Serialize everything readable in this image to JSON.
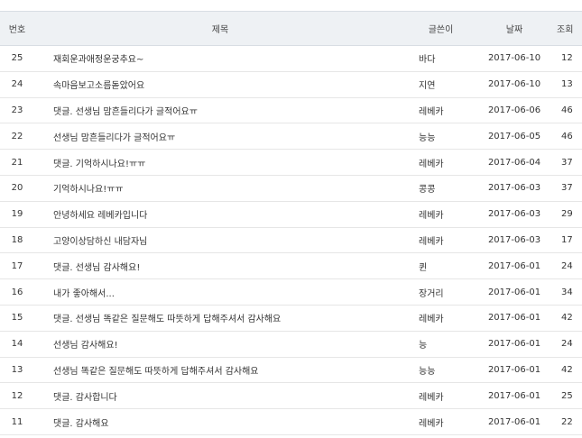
{
  "table": {
    "headers": {
      "no": "번호",
      "title": "제목",
      "author": "글쓴이",
      "date": "날짜",
      "views": "조회"
    },
    "rows": [
      {
        "no": "25",
        "title": "재회운과애정운궁추요~",
        "author": "바다",
        "date": "2017-06-10",
        "views": "12"
      },
      {
        "no": "24",
        "title": "속마음보고소름돋았어요",
        "author": "지연",
        "date": "2017-06-10",
        "views": "13"
      },
      {
        "no": "23",
        "title": "댓글. 선생님 맘흔들리다가 글적어요ㅠ",
        "author": "레베카",
        "date": "2017-06-06",
        "views": "46"
      },
      {
        "no": "22",
        "title": "선생님 맘흔들리다가 글적어요ㅠ",
        "author": "능능",
        "date": "2017-06-05",
        "views": "46"
      },
      {
        "no": "21",
        "title": "댓글. 기억하시나요!ㅠㅠ",
        "author": "레베카",
        "date": "2017-06-04",
        "views": "37"
      },
      {
        "no": "20",
        "title": "기억하시나요!ㅠㅠ",
        "author": "콩콩",
        "date": "2017-06-03",
        "views": "37"
      },
      {
        "no": "19",
        "title": "안녕하세요 레베카입니다",
        "author": "레베카",
        "date": "2017-06-03",
        "views": "29"
      },
      {
        "no": "18",
        "title": "고양이상담하신 내담자님",
        "author": "레베카",
        "date": "2017-06-03",
        "views": "17"
      },
      {
        "no": "17",
        "title": "댓글. 선생님 감사해요!",
        "author": "퀸",
        "date": "2017-06-01",
        "views": "24"
      },
      {
        "no": "16",
        "title": "내가 좋아해서...",
        "author": "장거리",
        "date": "2017-06-01",
        "views": "34"
      },
      {
        "no": "15",
        "title": "댓글. 선생님 똑같은 질문해도 따뜻하게 답해주셔서 감사해요",
        "author": "레베카",
        "date": "2017-06-01",
        "views": "42"
      },
      {
        "no": "14",
        "title": "선생님 감사해요!",
        "author": "능",
        "date": "2017-06-01",
        "views": "24"
      },
      {
        "no": "13",
        "title": "선생님 똑같은 질문해도 따뜻하게 답해주셔서 감사해요",
        "author": "능능",
        "date": "2017-06-01",
        "views": "42"
      },
      {
        "no": "12",
        "title": "댓글. 감사합니다",
        "author": "레베카",
        "date": "2017-06-01",
        "views": "25"
      },
      {
        "no": "11",
        "title": "댓글. 감사해요",
        "author": "레베카",
        "date": "2017-06-01",
        "views": "22"
      }
    ]
  }
}
